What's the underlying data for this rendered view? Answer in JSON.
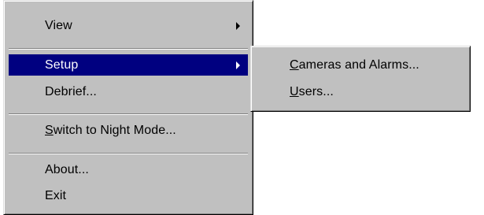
{
  "colors": {
    "menu_face": "#c0c0c0",
    "highlight": "#000080",
    "highlight_text": "#ffffff",
    "text": "#000000"
  },
  "main_menu": {
    "view": {
      "label": "View",
      "has_submenu": true
    },
    "setup": {
      "label": "Setup",
      "has_submenu": true,
      "highlighted": true
    },
    "debrief": {
      "label": "Debrief..."
    },
    "switch_night": {
      "mnemonic": "S",
      "rest": "witch to Night Mode..."
    },
    "about": {
      "label": "About..."
    },
    "exit": {
      "label": "Exit"
    }
  },
  "submenu": {
    "cameras": {
      "mnemonic": "C",
      "rest": "ameras and Alarms..."
    },
    "users": {
      "mnemonic": "U",
      "rest": "sers..."
    }
  },
  "icons": {
    "submenu_arrow": "chevron-right-icon"
  }
}
